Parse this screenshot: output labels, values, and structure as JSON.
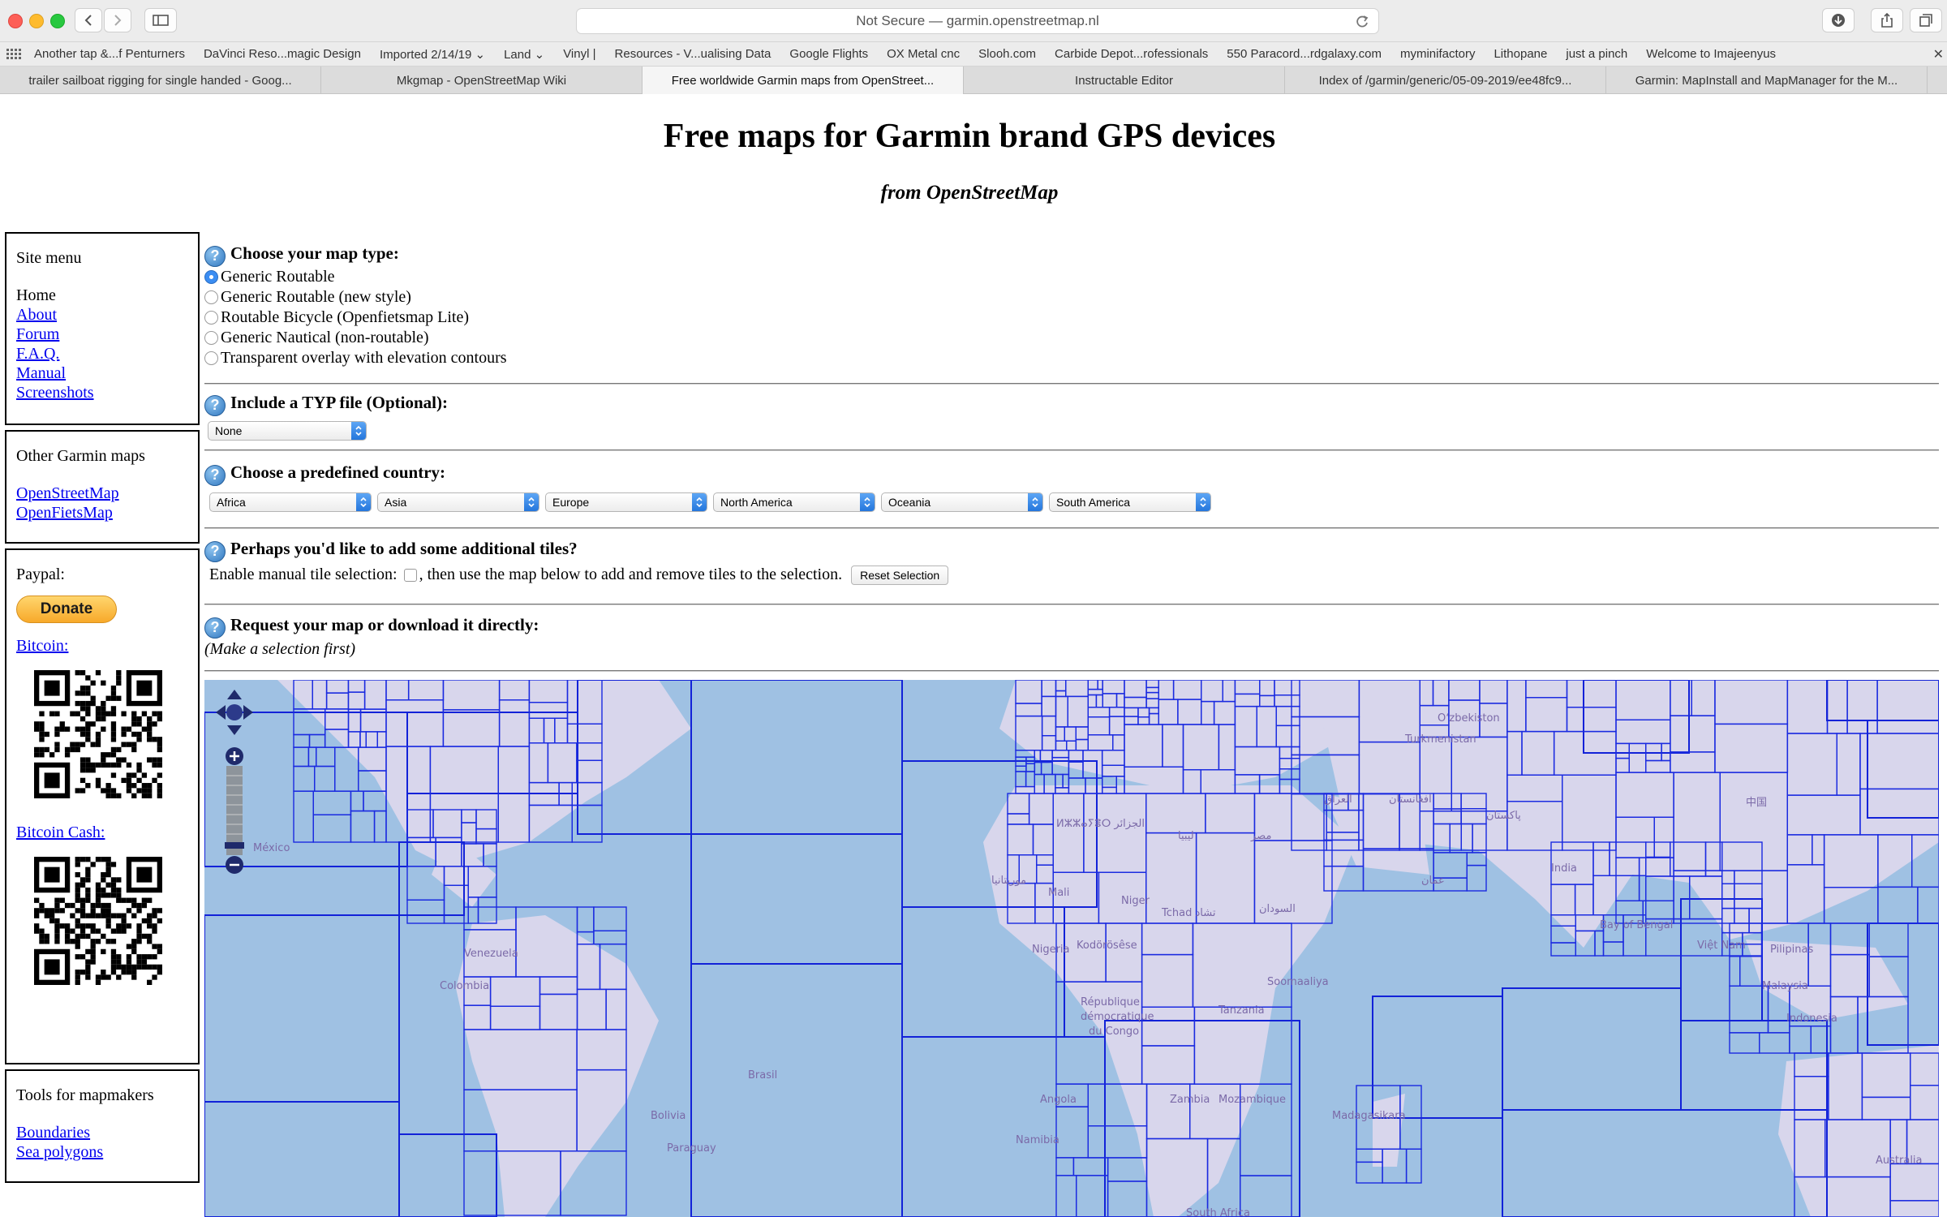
{
  "browser": {
    "url": "Not Secure — garmin.openstreetmap.nl",
    "bookmarks": [
      "Another tap &...f Penturners",
      "DaVinci Reso...magic Design",
      "Imported 2/14/19 ⌄",
      "Land ⌄",
      "Vinyl |",
      "Resources - V...ualising Data",
      "Google Flights",
      "OX Metal cnc",
      "Slooh.com",
      "Carbide Depot...rofessionals",
      "550 Paracord...rdgalaxy.com",
      "myminifactory",
      "Lithopane",
      "just a pinch",
      "Welcome to Imajeenyus"
    ],
    "tabs": [
      "trailer sailboat rigging for single handed - Goog...",
      "Mkgmap - OpenStreetMap Wiki",
      "Free worldwide Garmin maps from OpenStreet...",
      "Instructable Editor",
      "Index of /garmin/generic/05-09-2019/ee48fc9...",
      "Garmin: MapInstall and MapManager for the M..."
    ],
    "active_tab": 2
  },
  "page": {
    "title": "Free maps for Garmin brand GPS devices",
    "subtitle": "from OpenStreetMap"
  },
  "sidebar": {
    "site_menu": {
      "heading": "Site menu",
      "current": "Home",
      "links": [
        "About",
        "Forum",
        "F.A.Q.",
        "Manual",
        "Screenshots"
      ]
    },
    "other_maps": {
      "heading": "Other Garmin maps",
      "links": [
        "OpenStreetMap",
        "OpenFietsMap"
      ]
    },
    "support": {
      "paypal_label": "Paypal:",
      "donate_label": "Donate",
      "bitcoin_label": "Bitcoin:",
      "bitcoin_cash_label": "Bitcoin Cash:"
    },
    "tools": {
      "heading": "Tools for mapmakers",
      "links": [
        "Boundaries",
        "Sea polygons"
      ]
    }
  },
  "form": {
    "map_type": {
      "title": "Choose your map type:",
      "options": [
        "Generic Routable",
        "Generic Routable (new style)",
        "Routable Bicycle (Openfietsmap Lite)",
        "Generic Nautical (non-routable)",
        "Transparent overlay with elevation contours"
      ],
      "selected": 0
    },
    "typ_file": {
      "title": "Include a TYP file (Optional):",
      "value": "None"
    },
    "country": {
      "title": "Choose a predefined country:",
      "selects": [
        "Africa",
        "Asia",
        "Europe",
        "North America",
        "Oceania",
        "South America"
      ]
    },
    "tiles": {
      "title": "Perhaps you'd like to add some additional tiles?",
      "label_before": "Enable manual tile selection:",
      "label_after": ", then use the map below to add and remove tiles to the selection.",
      "reset_label": "Reset Selection"
    },
    "request": {
      "title": "Request your map or download it directly:",
      "note": "(Make a selection first)"
    }
  },
  "map": {
    "labels": [
      "Oʻzbekiston",
      "Turkmenistan",
      "العراق",
      "افغانستان",
      "پاکستان",
      "中国",
      "ⵍⵣⵣⴰⵢⴻⵔ الجزائر",
      "ليبيا",
      "مصر",
      "México",
      "موريتانيا",
      "Mali",
      "Niger",
      "Tchad تشاد",
      "السودان",
      "عمان",
      "India",
      "Bay of Bengal",
      "Việt Nam",
      "Pilipinas",
      "Venezuela",
      "Colombia",
      "Brasil",
      "Bolivia",
      "Paraguay",
      "Nigeria",
      "Kodörösêse",
      "République",
      "démocratique",
      "du Congo",
      "Tanzania",
      "Soomaaliya",
      "Zambia",
      "Mozambique",
      "Madagasikara",
      "Namibia",
      "Angola",
      "South Africa",
      "Malaysia",
      "Indonesia",
      "Australia"
    ]
  }
}
